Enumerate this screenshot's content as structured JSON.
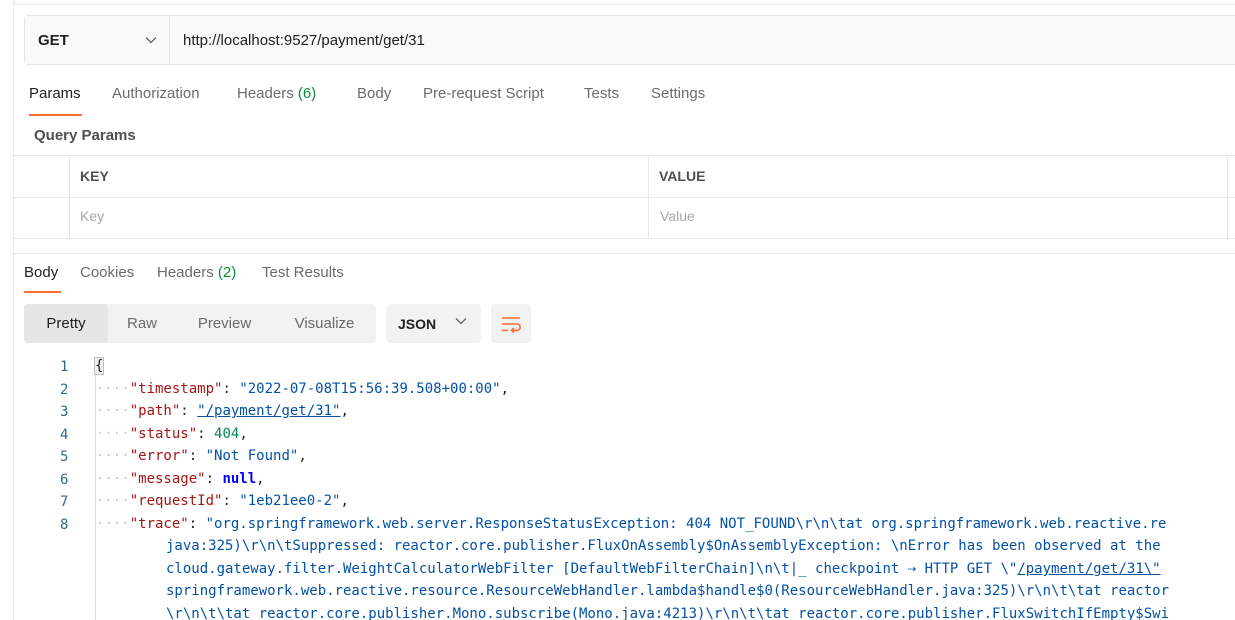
{
  "request": {
    "method": "GET",
    "url": "http://localhost:9527/payment/get/31"
  },
  "request_tabs": [
    {
      "label": "Params",
      "active": true
    },
    {
      "label": "Authorization"
    },
    {
      "label": "Headers",
      "count": "(6)"
    },
    {
      "label": "Body"
    },
    {
      "label": "Pre-request Script"
    },
    {
      "label": "Tests"
    },
    {
      "label": "Settings"
    }
  ],
  "query_params": {
    "title": "Query Params",
    "col_key": "KEY",
    "col_value": "VALUE",
    "key_placeholder": "Key",
    "value_placeholder": "Value"
  },
  "response_tabs": [
    {
      "label": "Body",
      "active": true
    },
    {
      "label": "Cookies"
    },
    {
      "label": "Headers",
      "count": "(2)"
    },
    {
      "label": "Test Results"
    }
  ],
  "view_modes": [
    "Pretty",
    "Raw",
    "Preview",
    "Visualize"
  ],
  "active_view_mode": "Pretty",
  "format": "JSON",
  "colors": {
    "accent": "#ff6c37",
    "count_green": "#0c8a3c",
    "json_key": "#a31515",
    "json_string": "#0451a5",
    "json_number": "#098658"
  },
  "response_lines": {
    "n1": "1",
    "n2": "2",
    "n3": "3",
    "n4": "4",
    "n5": "5",
    "n6": "6",
    "n7": "7",
    "n8": "8",
    "open_brace": "{",
    "indent": "····",
    "k_timestamp": "\"timestamp\"",
    "v_timestamp": "\"2022-07-08T15:56:39.508+00:00\"",
    "k_path": "\"path\"",
    "v_path": "\"/payment/get/31\"",
    "k_status": "\"status\"",
    "v_status": "404",
    "k_error": "\"error\"",
    "v_error": "\"Not Found\"",
    "k_message": "\"message\"",
    "v_message": "null",
    "k_requestId": "\"requestId\"",
    "v_requestId": "\"1eb21ee0-2\"",
    "k_trace": "\"trace\"",
    "trace_l1": "\"org.springframework.web.server.ResponseStatusException: 404 NOT_FOUND\\r\\n\\tat org.springframework.web.reactive.re",
    "trace_l2": "java:325)\\r\\n\\tSuppressed: reactor.core.publisher.FluxOnAssembly$OnAssemblyException: \\nError has been observed at the",
    "trace_l3a": "cloud.gateway.filter.WeightCalculatorWebFilter [DefaultWebFilterChain]\\n\\t|_ checkpoint ⇢ HTTP GET \\\"",
    "trace_l3link": "/payment/get/31\\\"",
    "trace_l4": "springframework.web.reactive.resource.ResourceWebHandler.lambda$handle$0(ResourceWebHandler.java:325)\\r\\n\\t\\tat reactor",
    "trace_l5": "\\r\\n\\t\\tat reactor.core.publisher.Mono.subscribe(Mono.java:4213)\\r\\n\\t\\tat reactor.core.publisher.FluxSwitchIfEmpty$Swi",
    "comma": ",",
    "colon": ": "
  }
}
